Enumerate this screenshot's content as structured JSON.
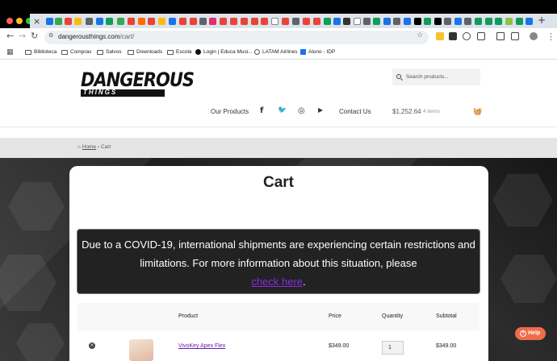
{
  "browser": {
    "url_domain": "dangerousthings.com",
    "url_path": "/cart/",
    "tab_close_glyph": "×",
    "new_tab_glyph": "+",
    "bookmarks": [
      {
        "label": "Biblioteca",
        "icon": "folder-icon"
      },
      {
        "label": "Compras",
        "icon": "folder-icon"
      },
      {
        "label": "Salvos",
        "icon": "folder-icon"
      },
      {
        "label": "Downloads",
        "icon": "folder-icon"
      },
      {
        "label": "Escola",
        "icon": "folder-icon"
      },
      {
        "label": "Login | Educa Musi...",
        "icon": "site-icon"
      },
      {
        "label": "LATAM Airlines",
        "icon": "globe-icon"
      },
      {
        "label": "Aluno - IDP",
        "icon": "site-icon"
      }
    ]
  },
  "site": {
    "logo_main": "DANGEROUS",
    "logo_sub": "THINGS",
    "search_placeholder": "Search products...",
    "nav": {
      "products": "Our Products",
      "contact": "Contact Us"
    },
    "social": {
      "facebook": "f",
      "twitter": "🐦",
      "instagram": "◎",
      "youtube": "▶"
    },
    "cart_total": "$1,252.64",
    "cart_items": "4 items"
  },
  "breadcrumb": {
    "home": "Home",
    "separator": "›",
    "current": "Cart"
  },
  "page": {
    "title": "Cart",
    "notice_text": "Due to a COVID-19, international shipments are experiencing certain restrictions and limitations. For more information about this situation, please",
    "notice_link": "check here",
    "notice_end": "."
  },
  "table": {
    "headers": {
      "product": "Product",
      "price": "Price",
      "quantity": "Quantity",
      "subtotal": "Subtotal"
    },
    "rows": [
      {
        "product": "VivoKey Apex Flex",
        "price": "$349.00",
        "quantity": "1",
        "subtotal": "$349.00"
      }
    ]
  },
  "help": {
    "label": "Help",
    "icon_glyph": "?"
  },
  "colors": {
    "accent_link": "#6a1bb4",
    "notice_link": "#8a2be2",
    "help": "#f06b4a"
  }
}
